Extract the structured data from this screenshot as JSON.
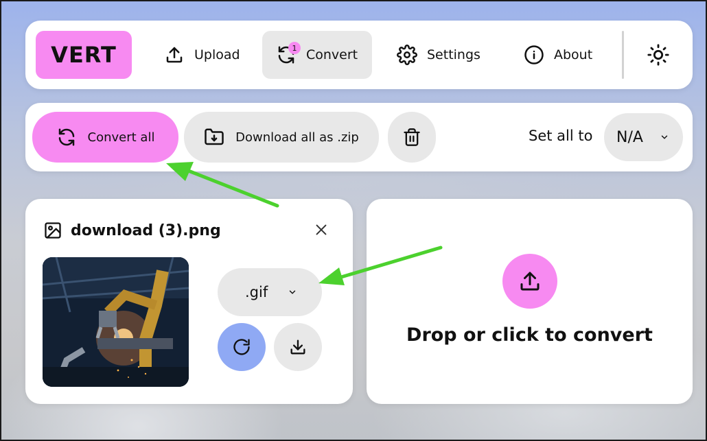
{
  "nav": {
    "logo": "VERT",
    "items": [
      {
        "label": "Upload",
        "icon": "upload-icon"
      },
      {
        "label": "Convert",
        "icon": "convert-icon",
        "badge": "1"
      },
      {
        "label": "Settings",
        "icon": "gear-icon"
      },
      {
        "label": "About",
        "icon": "info-icon"
      }
    ],
    "theme_icon": "sun-icon"
  },
  "toolbar": {
    "convert_all": "Convert all",
    "download_zip": "Download all as .zip",
    "trash_icon": "trash-icon",
    "set_all_label": "Set all to",
    "set_all_value": "N/A"
  },
  "file": {
    "name": "download (3).png",
    "format": ".gif"
  },
  "dropzone": {
    "text": "Drop or click to convert"
  },
  "colors": {
    "accent_pink": "#f78af1",
    "accent_blue": "#8fa9f4",
    "annotation_arrow": "#4cd12e"
  }
}
